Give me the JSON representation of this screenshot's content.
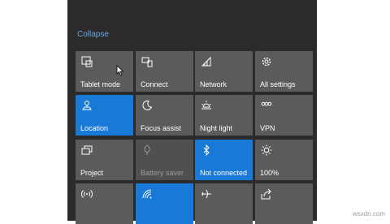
{
  "panel": {
    "collapse_label": "Collapse"
  },
  "tiles": [
    {
      "label": "Tablet mode",
      "icon": "tablet-mode-icon",
      "state": "selected"
    },
    {
      "label": "Connect",
      "icon": "connect-icon",
      "state": "normal"
    },
    {
      "label": "Network",
      "icon": "network-icon",
      "state": "normal"
    },
    {
      "label": "All settings",
      "icon": "gear-icon",
      "state": "normal"
    },
    {
      "label": "Location",
      "icon": "location-icon",
      "state": "active"
    },
    {
      "label": "Focus assist",
      "icon": "moon-icon",
      "state": "normal"
    },
    {
      "label": "Night light",
      "icon": "brightness-icon",
      "state": "normal"
    },
    {
      "label": "VPN",
      "icon": "vpn-icon",
      "state": "normal"
    },
    {
      "label": "Project",
      "icon": "project-icon",
      "state": "normal"
    },
    {
      "label": "Battery saver",
      "icon": "battery-saver-icon",
      "state": "disabled"
    },
    {
      "label": "Not connected",
      "icon": "bluetooth-icon",
      "state": "active"
    },
    {
      "label": "100%",
      "icon": "brightness-icon",
      "state": "normal"
    },
    {
      "label": "",
      "icon": "mobile-hotspot-icon",
      "state": "normal"
    },
    {
      "label": "",
      "icon": "wifi-icon",
      "state": "active"
    },
    {
      "label": "",
      "icon": "airplane-icon",
      "state": "normal"
    },
    {
      "label": "",
      "icon": "nearby-sharing-icon",
      "state": "normal"
    }
  ],
  "colors": {
    "accent": "#1979d6",
    "tile": "#5b5b5b",
    "panel": "#2b2b2b"
  },
  "watermark": "wsxdn.com"
}
